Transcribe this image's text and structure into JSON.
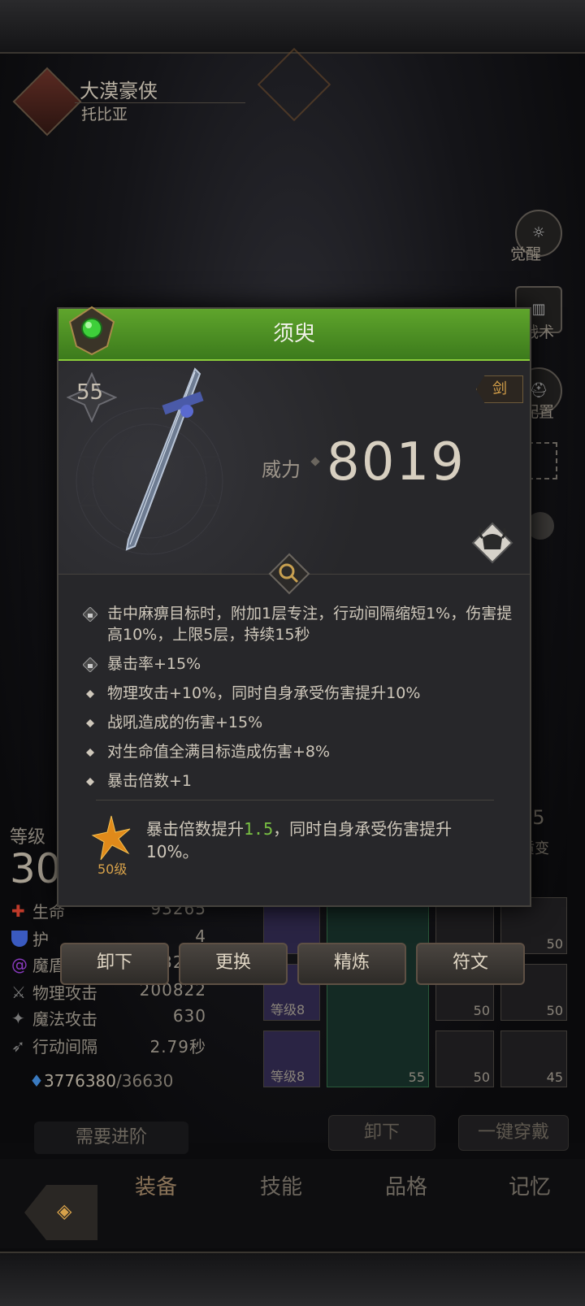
{
  "header": {
    "title": "大漠豪侠",
    "subtitle": "托比亚"
  },
  "side_menu": [
    {
      "label": "觉醒",
      "icon": "sun-icon"
    },
    {
      "label": "战术",
      "icon": "banner-icon"
    },
    {
      "label": "配置",
      "icon": "helmet-icon"
    },
    {
      "label": "",
      "icon": "frame-icon"
    },
    {
      "label": "",
      "icon": "mask-icon"
    }
  ],
  "popup": {
    "title": "须臾",
    "level": "55",
    "weapon_type": "剑",
    "power_label": "威力",
    "power_value": "8019",
    "affixes": [
      {
        "type": "lock",
        "text": "击中麻痹目标时，附加1层专注，行动间隔缩短1%，伤害提高10%，上限5层，持续15秒"
      },
      {
        "type": "lock",
        "text": "暴击率+15%"
      },
      {
        "type": "dot",
        "text": "物理攻击+10%，同时自身承受伤害提升10%"
      },
      {
        "type": "dot",
        "text": "战吼造成的伤害+15%"
      },
      {
        "type": "dot",
        "text": "对生命值全满目标造成伤害+8%"
      },
      {
        "type": "dot",
        "text": "暴击倍数+1"
      }
    ],
    "level_skill": {
      "level_label": "50级",
      "text_before": "暴击倍数提升",
      "highlight": "1.5",
      "text_after": "，同时自身承受伤害提升10%。"
    }
  },
  "actions": {
    "unequip": "卸下",
    "replace": "更换",
    "refine": "精炼",
    "rune": "符文"
  },
  "character": {
    "level_label": "等级",
    "level_value": "30",
    "stats": [
      {
        "label": "生命",
        "value": "93265",
        "icon": "heart-icon",
        "color": "#c03a2a"
      },
      {
        "label": "护",
        "value": "4",
        "icon": "shield-icon",
        "color": "#3a5ac0"
      },
      {
        "label": "魔盾",
        "value": "23248",
        "icon": "swirl-icon",
        "color": "#8a3ac0"
      },
      {
        "label": "物理攻击",
        "value": "200822",
        "icon": "sword-icon",
        "color": "#777"
      },
      {
        "label": "魔法攻击",
        "value": "630",
        "icon": "staff-icon",
        "color": "#777"
      },
      {
        "label": "行动间隔",
        "value": "2.79秒",
        "icon": "wing-icon",
        "color": "#777"
      }
    ],
    "exp_current": "3776380",
    "exp_total": "/36630",
    "advance_label": "需要进阶"
  },
  "transmute": {
    "value": "45",
    "label": "质变"
  },
  "slots": [
    {
      "label": "等级8",
      "level": ""
    },
    {
      "label": "等级8",
      "level": ""
    },
    {
      "label": "",
      "level": "55"
    },
    {
      "label": "",
      "level": "50"
    },
    {
      "label": "",
      "level": "50"
    },
    {
      "label": "",
      "level": "50"
    },
    {
      "label": "",
      "level": "50"
    },
    {
      "label": "",
      "level": "50"
    },
    {
      "label": "",
      "level": "45"
    }
  ],
  "inventory_buttons": {
    "unequip": "卸下",
    "equip_all": "一键穿戴"
  },
  "nav": {
    "tabs": [
      "装备",
      "技能",
      "品格",
      "记忆"
    ]
  },
  "colors": {
    "header_green": "#5fa52c",
    "accent_gold": "#d8a24a",
    "highlight_green": "#79c043"
  }
}
